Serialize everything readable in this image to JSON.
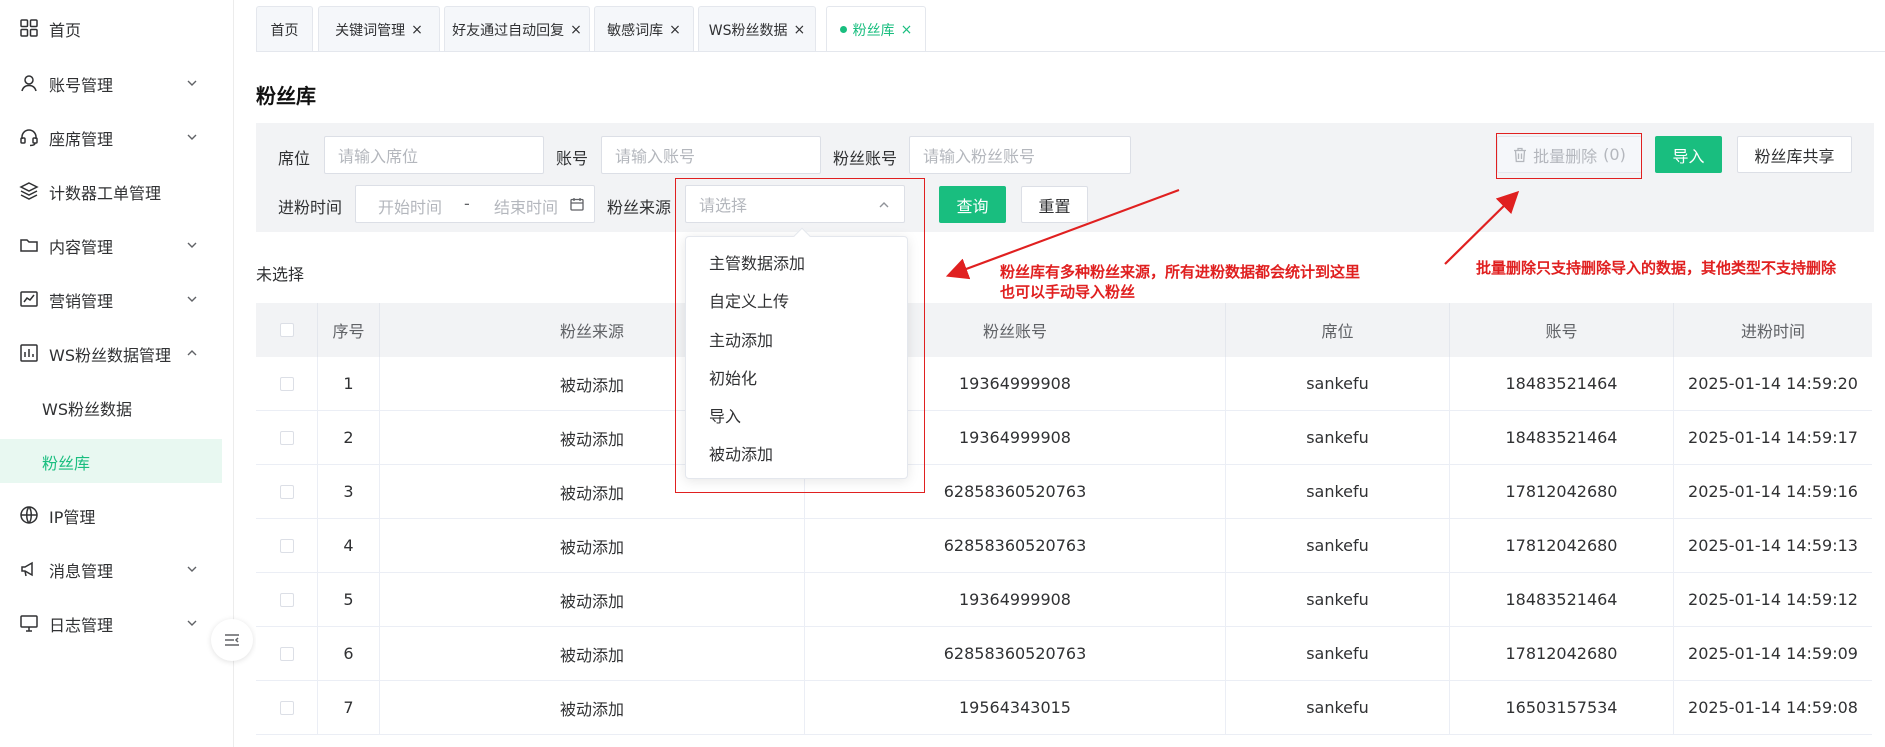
{
  "sidebar": {
    "items": [
      {
        "label": "首页",
        "icon": "grid-icon",
        "expanded": null
      },
      {
        "label": "账号管理",
        "icon": "user-icon",
        "expanded": false
      },
      {
        "label": "座席管理",
        "icon": "headset-icon",
        "expanded": false
      },
      {
        "label": "计数器工单管理",
        "icon": "layers-icon",
        "expanded": null
      },
      {
        "label": "内容管理",
        "icon": "folder-icon",
        "expanded": false
      },
      {
        "label": "营销管理",
        "icon": "chart-line-icon",
        "expanded": false
      },
      {
        "label": "WS粉丝数据管理",
        "icon": "bar-chart-icon",
        "expanded": true
      },
      {
        "label": "WS粉丝数据",
        "icon": null,
        "expanded": null
      },
      {
        "label": "粉丝库",
        "icon": null,
        "expanded": null,
        "active": true
      },
      {
        "label": "IP管理",
        "icon": "globe-icon",
        "expanded": null
      },
      {
        "label": "消息管理",
        "icon": "megaphone-icon",
        "expanded": false
      },
      {
        "label": "日志管理",
        "icon": "monitor-icon",
        "expanded": false
      }
    ]
  },
  "tabs": [
    {
      "label": "首页",
      "closable": false
    },
    {
      "label": "关键词管理",
      "closable": true
    },
    {
      "label": "好友通过自动回复",
      "closable": true
    },
    {
      "label": "敏感词库",
      "closable": true
    },
    {
      "label": "WS粉丝数据",
      "closable": true
    },
    {
      "label": "粉丝库",
      "closable": true,
      "active": true
    }
  ],
  "close_glyph": "×",
  "page_title": "粉丝库",
  "filters": {
    "seat_label": "席位",
    "seat_placeholder": "请输入席位",
    "account_label": "账号",
    "account_placeholder": "请输入账号",
    "fan_account_label": "粉丝账号",
    "fan_account_placeholder": "请输入粉丝账号",
    "time_label": "进粉时间",
    "start_placeholder": "开始时间",
    "separator": "-",
    "end_placeholder": "结束时间",
    "source_label": "粉丝来源",
    "source_placeholder": "请选择",
    "query_button": "查询",
    "reset_button": "重置",
    "batch_delete_button": "批量删除",
    "batch_delete_count": "(0)",
    "import_button": "导入",
    "share_button": "粉丝库共享"
  },
  "selection_status": "未选择",
  "table": {
    "columns": [
      "序号",
      "粉丝来源",
      "粉丝账号",
      "席位",
      "账号",
      "进粉时间"
    ],
    "rows": [
      {
        "no": "1",
        "source": "被动添加",
        "fan_account": "19364999908",
        "seat": "sankefu",
        "account": "18483521464",
        "time": "2025-01-14 14:59:20"
      },
      {
        "no": "2",
        "source": "被动添加",
        "fan_account": "19364999908",
        "seat": "sankefu",
        "account": "18483521464",
        "time": "2025-01-14 14:59:17"
      },
      {
        "no": "3",
        "source": "被动添加",
        "fan_account": "62858360520763",
        "seat": "sankefu",
        "account": "17812042680",
        "time": "2025-01-14 14:59:16"
      },
      {
        "no": "4",
        "source": "被动添加",
        "fan_account": "62858360520763",
        "seat": "sankefu",
        "account": "17812042680",
        "time": "2025-01-14 14:59:13"
      },
      {
        "no": "5",
        "source": "被动添加",
        "fan_account": "19364999908",
        "seat": "sankefu",
        "account": "18483521464",
        "time": "2025-01-14 14:59:12"
      },
      {
        "no": "6",
        "source": "被动添加",
        "fan_account": "62858360520763",
        "seat": "sankefu",
        "account": "17812042680",
        "time": "2025-01-14 14:59:09"
      },
      {
        "no": "7",
        "source": "被动添加",
        "fan_account": "19564343015",
        "seat": "sankefu",
        "account": "16503157534",
        "time": "2025-01-14 14:59:08"
      }
    ]
  },
  "source_dropdown": {
    "options": [
      "主管数据添加",
      "自定义上传",
      "主动添加",
      "初始化",
      "导入",
      "被动添加"
    ]
  },
  "annotations": {
    "source_note_line1": "粉丝库有多种粉丝来源，所有进粉数据都会统计到这里",
    "source_note_line2": "也可以手动导入粉丝",
    "delete_note": "批量删除只支持删除导入的数据，其他类型不支持删除"
  },
  "colors": {
    "accent": "#19be7f",
    "annotation": "#e02020"
  }
}
